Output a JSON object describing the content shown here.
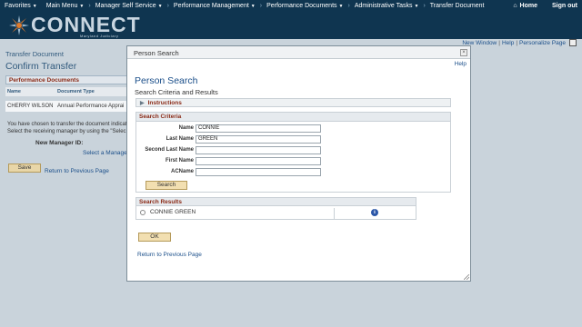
{
  "topnav": {
    "favorites": "Favorites",
    "main_menu": "Main Menu",
    "manager_self_service": "Manager Self Service",
    "performance_management": "Performance Management",
    "performance_documents": "Performance Documents",
    "administrative_tasks": "Administrative Tasks",
    "transfer_document": "Transfer Document",
    "home": "Home",
    "sign_out": "Sign out"
  },
  "banner": {
    "logo_text": "CONNECT",
    "logo_sub": "Maryland Judiciary"
  },
  "page": {
    "toplinks": {
      "new_window": "New Window",
      "help": "Help",
      "personalize": "Personalize Page",
      "sep": "|"
    },
    "breadcrumb": "Transfer Document",
    "title": "Confirm Transfer",
    "performance_documents_header": "Performance Documents",
    "table_headers": {
      "name": "Name",
      "document_type": "Document Type"
    },
    "table_row": {
      "name": "CHERRY WILSON",
      "document_type": "Annual Performance Apprai"
    },
    "message_line1": "You have chosen to transfer the document indicat",
    "message_line2": "Select the receiving manager by using the \"Selec",
    "new_manager_label": "New Manager ID:",
    "select_manager_link": "Select a Manager",
    "save_label": "Save",
    "return_link": "Return to Previous Page"
  },
  "modal": {
    "titlebar": "Person Search",
    "close": "×",
    "help": "Help",
    "title": "Person Search",
    "subtitle": "Search Criteria and Results",
    "instructions": "Instructions",
    "criteria_header": "Search Criteria",
    "fields": {
      "name": {
        "label": "Name",
        "value": "CONNIE"
      },
      "last_name": {
        "label": "Last Name",
        "value": "GREEN"
      },
      "second_last_name": {
        "label": "Second Last Name",
        "value": ""
      },
      "first_name": {
        "label": "First Name",
        "value": ""
      },
      "acname": {
        "label": "ACName",
        "value": ""
      }
    },
    "search_label": "Search",
    "results_header": "Search Results",
    "result_name": "CONNIE GREEN",
    "info_icon_glyph": "i",
    "ok_label": "OK",
    "return_link": "Return to Previous Page"
  }
}
